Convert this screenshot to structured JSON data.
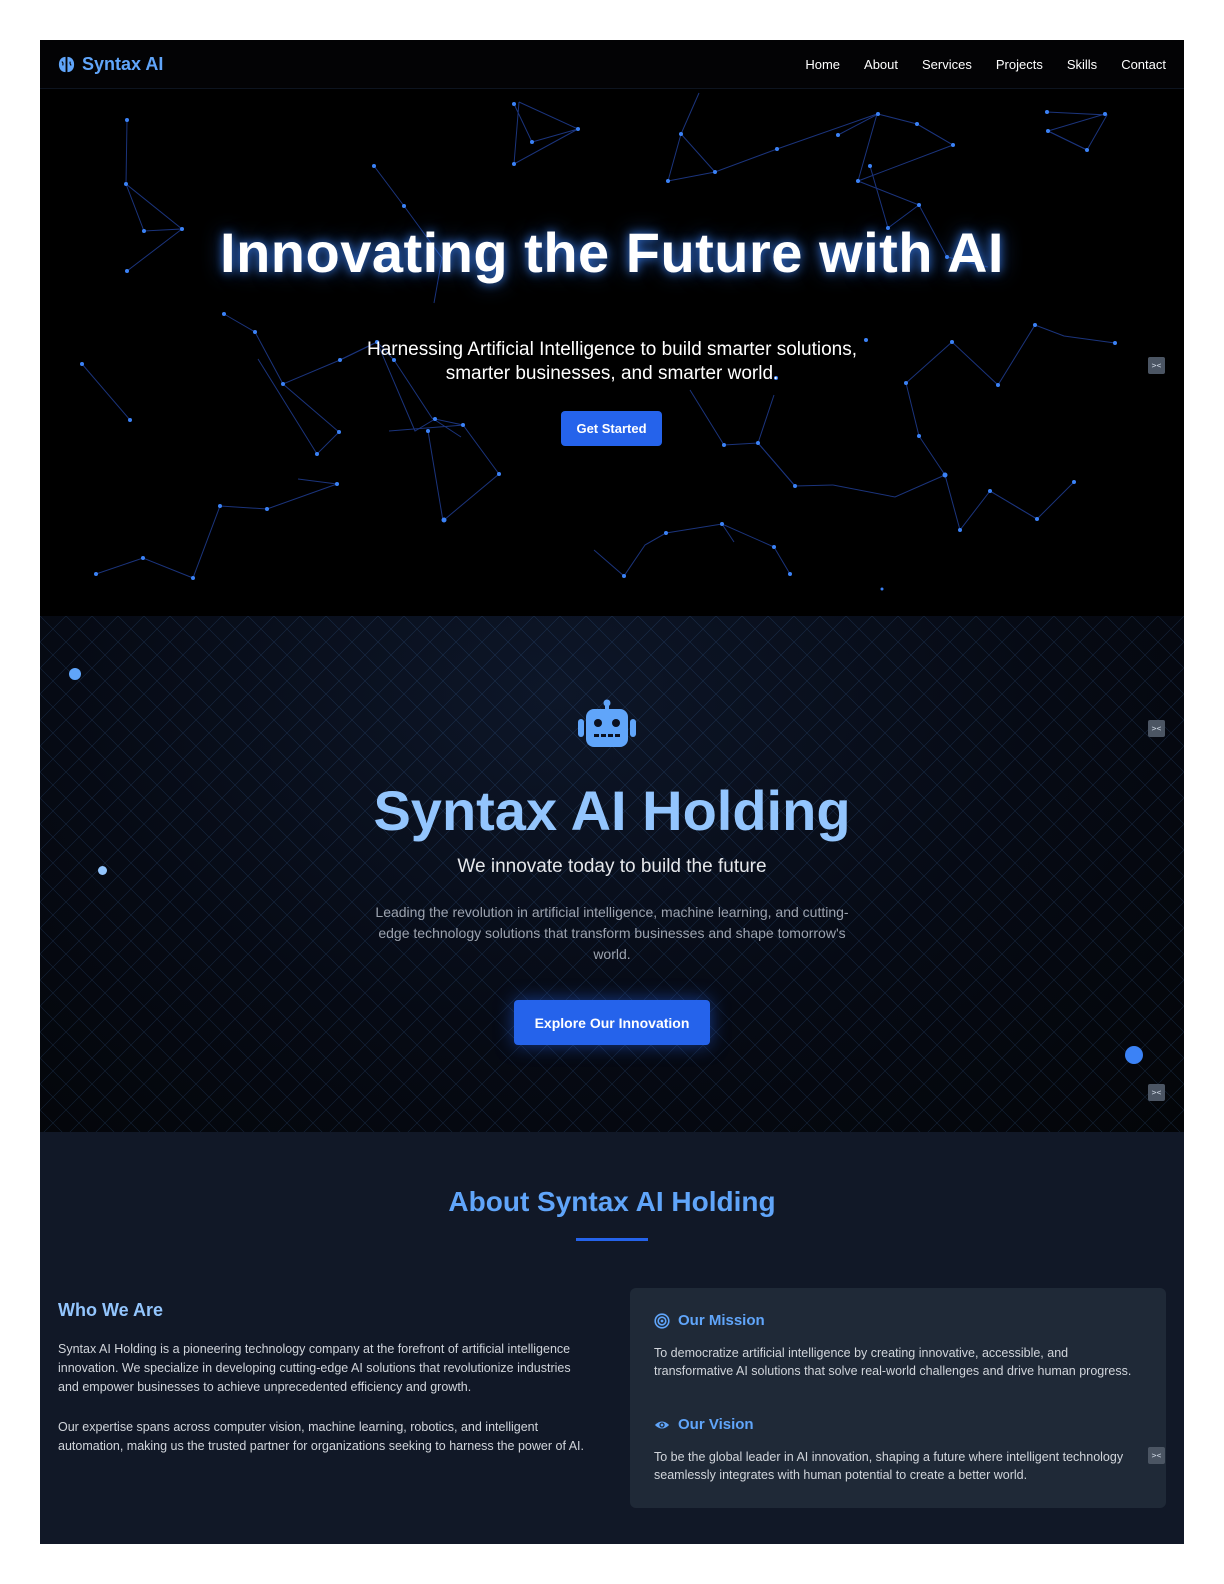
{
  "nav": {
    "brand": "Syntax AI",
    "links": [
      "Home",
      "About",
      "Services",
      "Projects",
      "Skills",
      "Contact"
    ]
  },
  "hero": {
    "title": "Innovating the Future with AI",
    "subtitle_line1": "Harnessing Artificial Intelligence to build smarter solutions,",
    "subtitle_line2": "smarter businesses, and smarter world.",
    "cta": "Get Started"
  },
  "holding": {
    "icon": "robot-icon",
    "title": "Syntax AI Holding",
    "tagline": "We innovate today to build the future",
    "description": "Leading the revolution in artificial intelligence, machine learning, and cutting-edge technology solutions that transform businesses and shape tomorrow's world.",
    "cta": "Explore Our Innovation"
  },
  "about": {
    "title": "About Syntax AI Holding",
    "who_title": "Who We Are",
    "who_p1": "Syntax AI Holding is a pioneering technology company at the forefront of artificial intelligence innovation. We specialize in developing cutting-edge AI solutions that revolutionize industries and empower businesses to achieve unprecedented efficiency and growth.",
    "who_p2": "Our expertise spans across computer vision, machine learning, robotics, and intelligent automation, making us the trusted partner for organizations seeking to harness the power of AI.",
    "mission_title": "Our Mission",
    "mission_text": "To democratize artificial intelligence by creating innovative, accessible, and transformative AI solutions that solve real-world challenges and drive human progress.",
    "vision_title": "Our Vision",
    "vision_text": "To be the global leader in AI innovation, shaping a future where intelligent technology seamlessly integrates with human potential to create a better world."
  },
  "colors": {
    "accent": "#2563eb",
    "brand": "#60a5fa",
    "heading_light": "#93c5fd",
    "about_bg": "#111827",
    "card_bg": "#1f2937"
  }
}
